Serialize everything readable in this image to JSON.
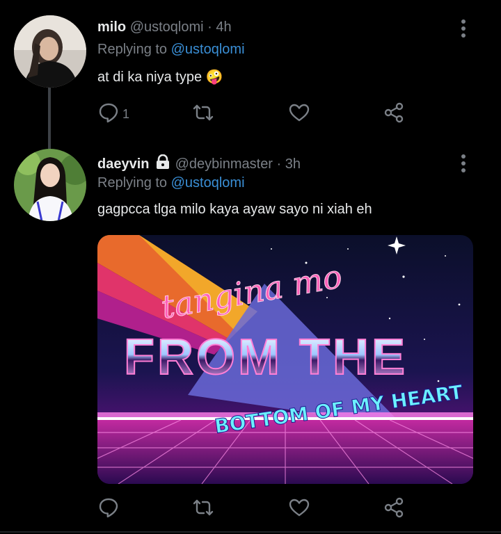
{
  "tweets": [
    {
      "display_name": "milo",
      "handle": "@ustoqlomi",
      "separator": "·",
      "time": "4h",
      "replying_prefix": "Replying to",
      "replying_to": "@ustoqlomi",
      "text": "at di ka niya type 🤪",
      "reply_count": "1"
    },
    {
      "display_name": "daeyvin",
      "handle": "@deybinmaster",
      "separator": "·",
      "time": "3h",
      "replying_prefix": "Replying to",
      "replying_to": "@ustoqlomi",
      "text": "gagpcca tlga milo kaya ayaw sayo ni xiah eh",
      "reply_count": "",
      "media": {
        "line1": "tangina mo",
        "line2": "FROM THE",
        "line3": "BOTTOM OF MY HEART"
      }
    }
  ],
  "icons": [
    "more-vertical-icon",
    "reply-icon",
    "retweet-icon",
    "like-icon",
    "share-icon",
    "lock-icon"
  ],
  "colors": {
    "background": "#000000",
    "text": "#e7e9ea",
    "muted": "#7b8087",
    "link": "#3a8fd6"
  }
}
